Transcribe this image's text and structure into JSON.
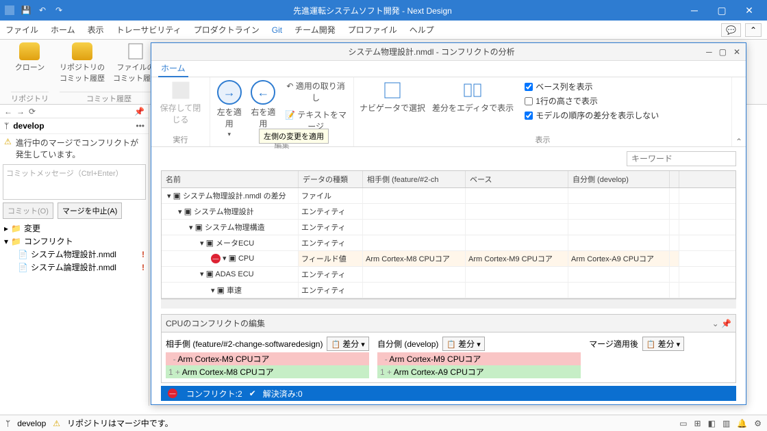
{
  "titlebar": {
    "title": "先進運転システムソフト開発 - Next Design"
  },
  "menu": {
    "items": [
      "ファイル",
      "ホーム",
      "表示",
      "トレーサビリティ",
      "プロダクトライン",
      "Git",
      "チーム開発",
      "プロファイル",
      "ヘルプ"
    ]
  },
  "ribbon": {
    "clone": "クローン",
    "repo_hist": "リポジトリの\nコミット履歴",
    "file_hist": "ファイルの\nコミット履歴",
    "repo_cap": "リポジトリ",
    "hist_cap": "コミット履歴"
  },
  "left": {
    "branch": "develop",
    "warn": "進行中のマージでコンフリクトが発生しています。",
    "commit_ph": "コミットメッセージ（Ctrl+Enter）",
    "commit_btn": "コミット(O)",
    "abort_btn": "マージを中止(A)",
    "changes": "変更",
    "conflicts": "コンフリクト",
    "files": [
      "システム物理設計.nmdl",
      "システム論理設計.nmdl"
    ]
  },
  "cw": {
    "title": "システム物理設計.nmdl - コンフリクトの分析",
    "tab": "ホーム",
    "save": "保存して閉じる",
    "exec": "実行",
    "apply_left": "左を適用",
    "apply_right": "右を適用",
    "tooltip": "左側の変更を適用",
    "undo": "適用の取り消し",
    "merge_text": "テキストをマージ",
    "edit_cap": "編集",
    "nav_sel": "ナビゲータで選択",
    "diff_edit": "差分をエディタで表示",
    "chk_base": "ベース列を表示",
    "chk_row1": "1行の高さで表示",
    "chk_order": "モデルの順序の差分を表示しない",
    "view_cap": "表示",
    "keyword": "キーワード",
    "grid": {
      "h": [
        "名前",
        "データの種類",
        "相手側 (feature/#2-ch",
        "ベース",
        "自分側 (develop)"
      ],
      "rows": [
        {
          "indent": 0,
          "name": "システム物理設計.nmdl の差分",
          "type": "ファイル"
        },
        {
          "indent": 1,
          "name": "システム物理設計",
          "type": "エンティティ"
        },
        {
          "indent": 2,
          "name": "システム物理構造",
          "type": "エンティティ"
        },
        {
          "indent": 3,
          "name": "メータECU",
          "type": "エンティティ"
        },
        {
          "indent": 4,
          "name": "CPU",
          "type": "フィールド値",
          "their": "Arm Cortex-M8 CPUコア",
          "base": "Arm Cortex-M9 CPUコア",
          "mine": "Arm Cortex-A9 CPUコア",
          "conflict": true
        },
        {
          "indent": 3,
          "name": "ADAS ECU",
          "type": "エンティティ"
        },
        {
          "indent": 4,
          "name": "車速",
          "type": "エンティティ"
        }
      ]
    },
    "editor": {
      "title": "CPUのコンフリクトの編集",
      "their_h": "相手側 (feature/#2-change-softwaredesign)",
      "mine_h": "自分側 (develop)",
      "merged_h": "マージ適用後",
      "diff_btn": "差分",
      "their_del": "Arm Cortex-M9 CPUコア",
      "their_add": "Arm Cortex-M8 CPUコア",
      "mine_del": "Arm Cortex-M9 CPUコア",
      "mine_add": "Arm Cortex-A9 CPUコア"
    },
    "status": {
      "conf": "コンフリクト:2",
      "done": "解決済み:0"
    }
  },
  "status": {
    "branch": "develop",
    "msg": "リポジトリはマージ中です。"
  }
}
